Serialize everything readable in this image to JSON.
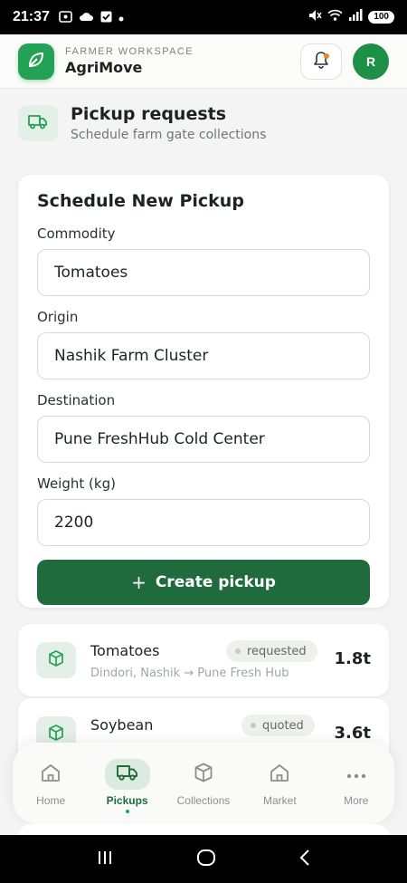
{
  "status_bar": {
    "time": "21:37",
    "left_icons": [
      "screen-record-icon",
      "cloud-icon",
      "check-box-icon",
      "dot-icon"
    ],
    "right_icons": [
      "mute-icon",
      "wifi-icon",
      "signal-icon"
    ],
    "battery": "100"
  },
  "header": {
    "brand_sub": "FARMER WORKSPACE",
    "brand_title": "AgriMove",
    "avatar_initial": "R",
    "colors": {
      "brand": "#23a154",
      "avatar": "#1e8f47",
      "notification_dot": "#e5862a"
    }
  },
  "page": {
    "title": "Pickup requests",
    "subtitle": "Schedule farm gate collections"
  },
  "form": {
    "title": "Schedule New Pickup",
    "fields": [
      {
        "label": "Commodity",
        "value": "Tomatoes"
      },
      {
        "label": "Origin",
        "value": "Nashik Farm Cluster"
      },
      {
        "label": "Destination",
        "value": "Pune FreshHub Cold Center"
      },
      {
        "label": "Weight (kg)",
        "value": "2200"
      }
    ],
    "submit_label": "Create pickup",
    "submit_color": "#1f6b3d"
  },
  "pickups": [
    {
      "commodity": "Tomatoes",
      "route": "Dindori, Nashik → Pune Fresh Hub",
      "status": "requested",
      "weight": "1.8t"
    },
    {
      "commodity": "Soybean",
      "status": "quoted",
      "weight": "3.6t"
    }
  ],
  "bottom_nav": {
    "items": [
      {
        "label": "Home",
        "icon": "home-icon",
        "active": false
      },
      {
        "label": "Pickups",
        "icon": "truck-icon",
        "active": true
      },
      {
        "label": "Collections",
        "icon": "box-icon",
        "active": false
      },
      {
        "label": "Market",
        "icon": "market-icon",
        "active": false
      },
      {
        "label": "More",
        "icon": "more-dots-icon",
        "active": false
      }
    ]
  },
  "system_nav": [
    "recents-icon",
    "home-circle-icon",
    "back-icon"
  ]
}
